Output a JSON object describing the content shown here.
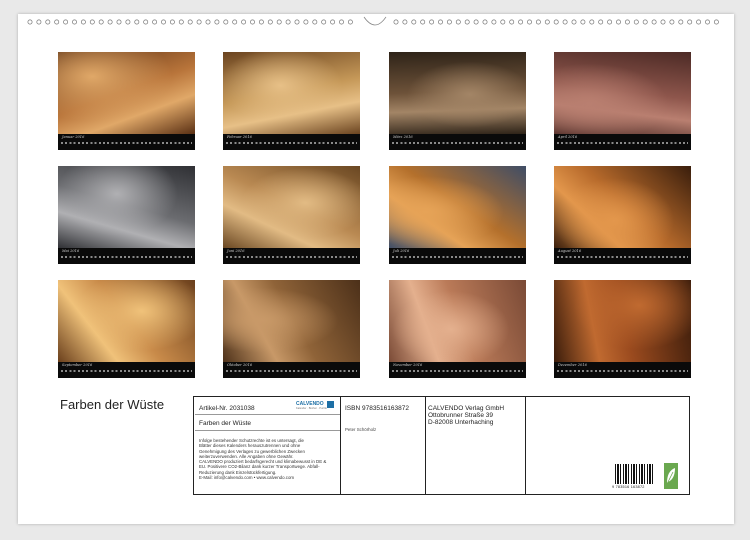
{
  "calendar": {
    "title": "Farben der Wüste"
  },
  "thumbnails": [
    {
      "month": "Januar 2016",
      "colors": [
        "#5a3014",
        "#b8743a",
        "#e0a868"
      ]
    },
    {
      "month": "Februar 2016",
      "colors": [
        "#6b4420",
        "#c59858",
        "#e7c087"
      ]
    },
    {
      "month": "März 2016",
      "colors": [
        "#2e2318",
        "#6d5239",
        "#a38566"
      ]
    },
    {
      "month": "April 2016",
      "colors": [
        "#4c2a25",
        "#8e564c",
        "#b97f70"
      ]
    },
    {
      "month": "Mai 2016",
      "colors": [
        "#2f3034",
        "#6b6c70",
        "#b0b0b3"
      ]
    },
    {
      "month": "Juni 2016",
      "colors": [
        "#6a4722",
        "#b98952",
        "#e2bb84"
      ]
    },
    {
      "month": "Juli 2016",
      "colors": [
        "#3f4d66",
        "#b4702c",
        "#e6a357"
      ]
    },
    {
      "month": "August 2016",
      "colors": [
        "#3a1e0c",
        "#b76a2b",
        "#e3974c"
      ]
    },
    {
      "month": "September 2016",
      "colors": [
        "#6a3f1c",
        "#c88a49",
        "#f0c27a"
      ]
    },
    {
      "month": "Oktober 2016",
      "colors": [
        "#4c3019",
        "#8f6338",
        "#c89968"
      ]
    },
    {
      "month": "November 2016",
      "colors": [
        "#7a4a36",
        "#ba7a58",
        "#e4b08e"
      ]
    },
    {
      "month": "Dezember 2016",
      "colors": [
        "#3a1c0b",
        "#9a4a1e",
        "#c06a30"
      ]
    }
  ],
  "info": {
    "article": "Artikel-Nr. 2031038",
    "brand": "CALVENDO",
    "brand_tagline": "Kalender · Bücher · Puzzle",
    "cal_title": "Farben der Wüste",
    "isbn": "ISBN 9783516163872",
    "author": "Peter Schörholz",
    "publisher": [
      "CALVENDO Verlag GmbH",
      "Ottobrunner Straße 39",
      "D-82008 Unterhaching"
    ],
    "legal": [
      "Infolge bestehender Schutzrechte ist es untersagt, die",
      "Blätter dieses Kalenders herauszutrennen und ohne",
      "Genehmigung des Verlages zu gewerblichen Zwecken",
      "weiterzuverwenden. Alle Angaben ohne Gewähr.",
      "CALVENDO produziert bedarfsgerecht und klimabewusst in DE &",
      "EU. Positivere CO2-Bilanz dank kurzer Transportwege. Abfall-",
      "Reduzierung dank Einzelstückfertigung.",
      "E-Mail: info@calvendo.com • www.calvendo.com"
    ],
    "barcode_number": "9 783516 163872"
  }
}
